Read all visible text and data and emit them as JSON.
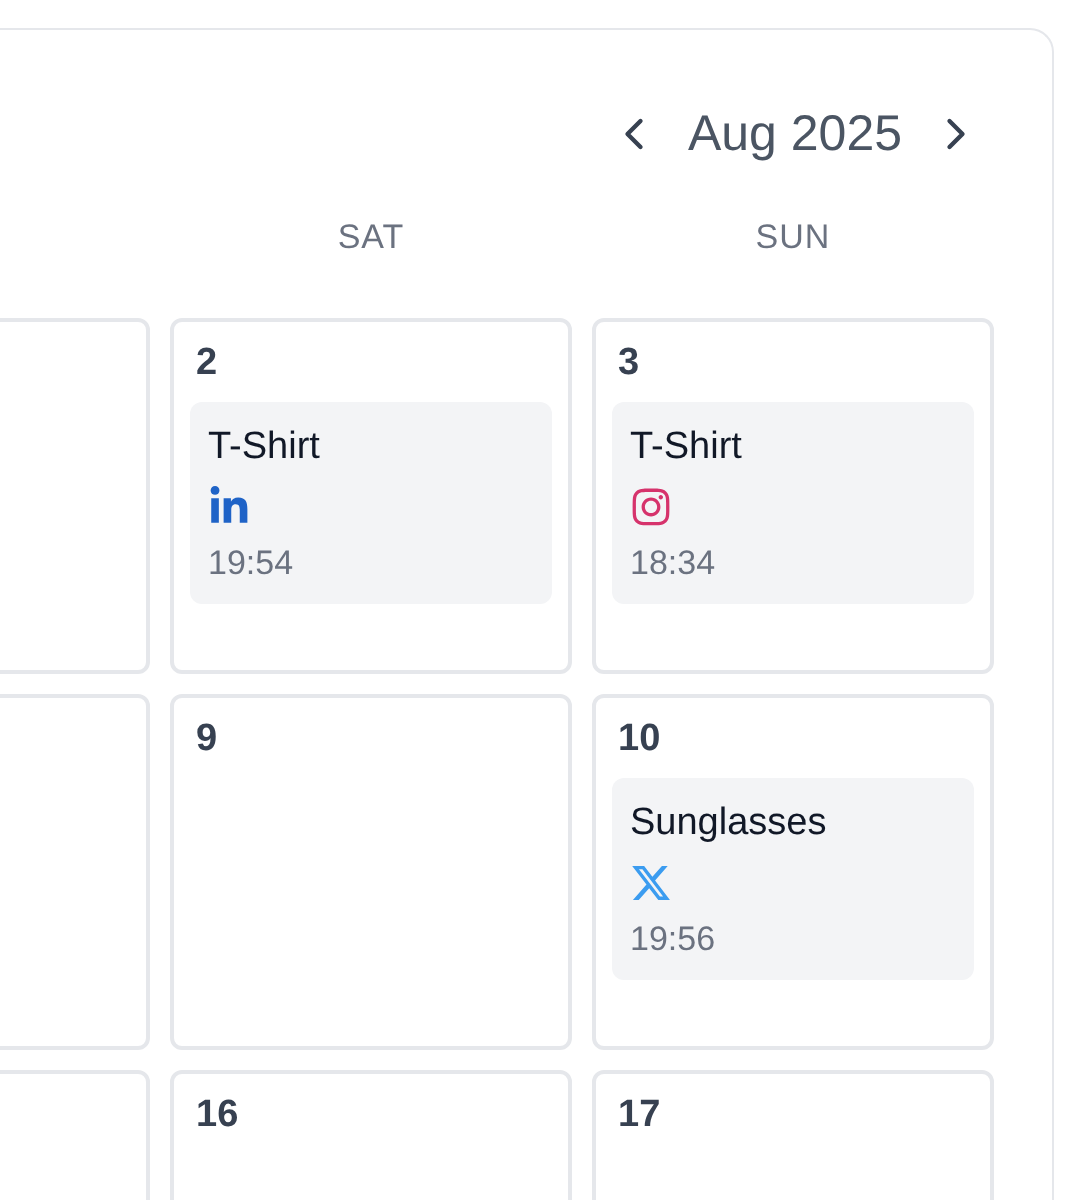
{
  "header": {
    "month": "Aug 2025"
  },
  "day_headers": [
    "SAT",
    "SUN"
  ],
  "weeks": [
    {
      "cells": [
        {
          "day": "2",
          "events": [
            {
              "title": "T-Shirt",
              "kind": "linkedin",
              "time": "19:54"
            }
          ]
        },
        {
          "day": "3",
          "events": [
            {
              "title": "T-Shirt",
              "kind": "instagram",
              "time": "18:34"
            }
          ]
        }
      ]
    },
    {
      "cells": [
        {
          "day": "9"
        },
        {
          "day": "10",
          "events": [
            {
              "title": "Sunglasses",
              "kind": "x",
              "time": "19:56"
            }
          ]
        }
      ]
    },
    {
      "cells": [
        {
          "day": "16"
        },
        {
          "day": "17"
        }
      ]
    }
  ]
}
